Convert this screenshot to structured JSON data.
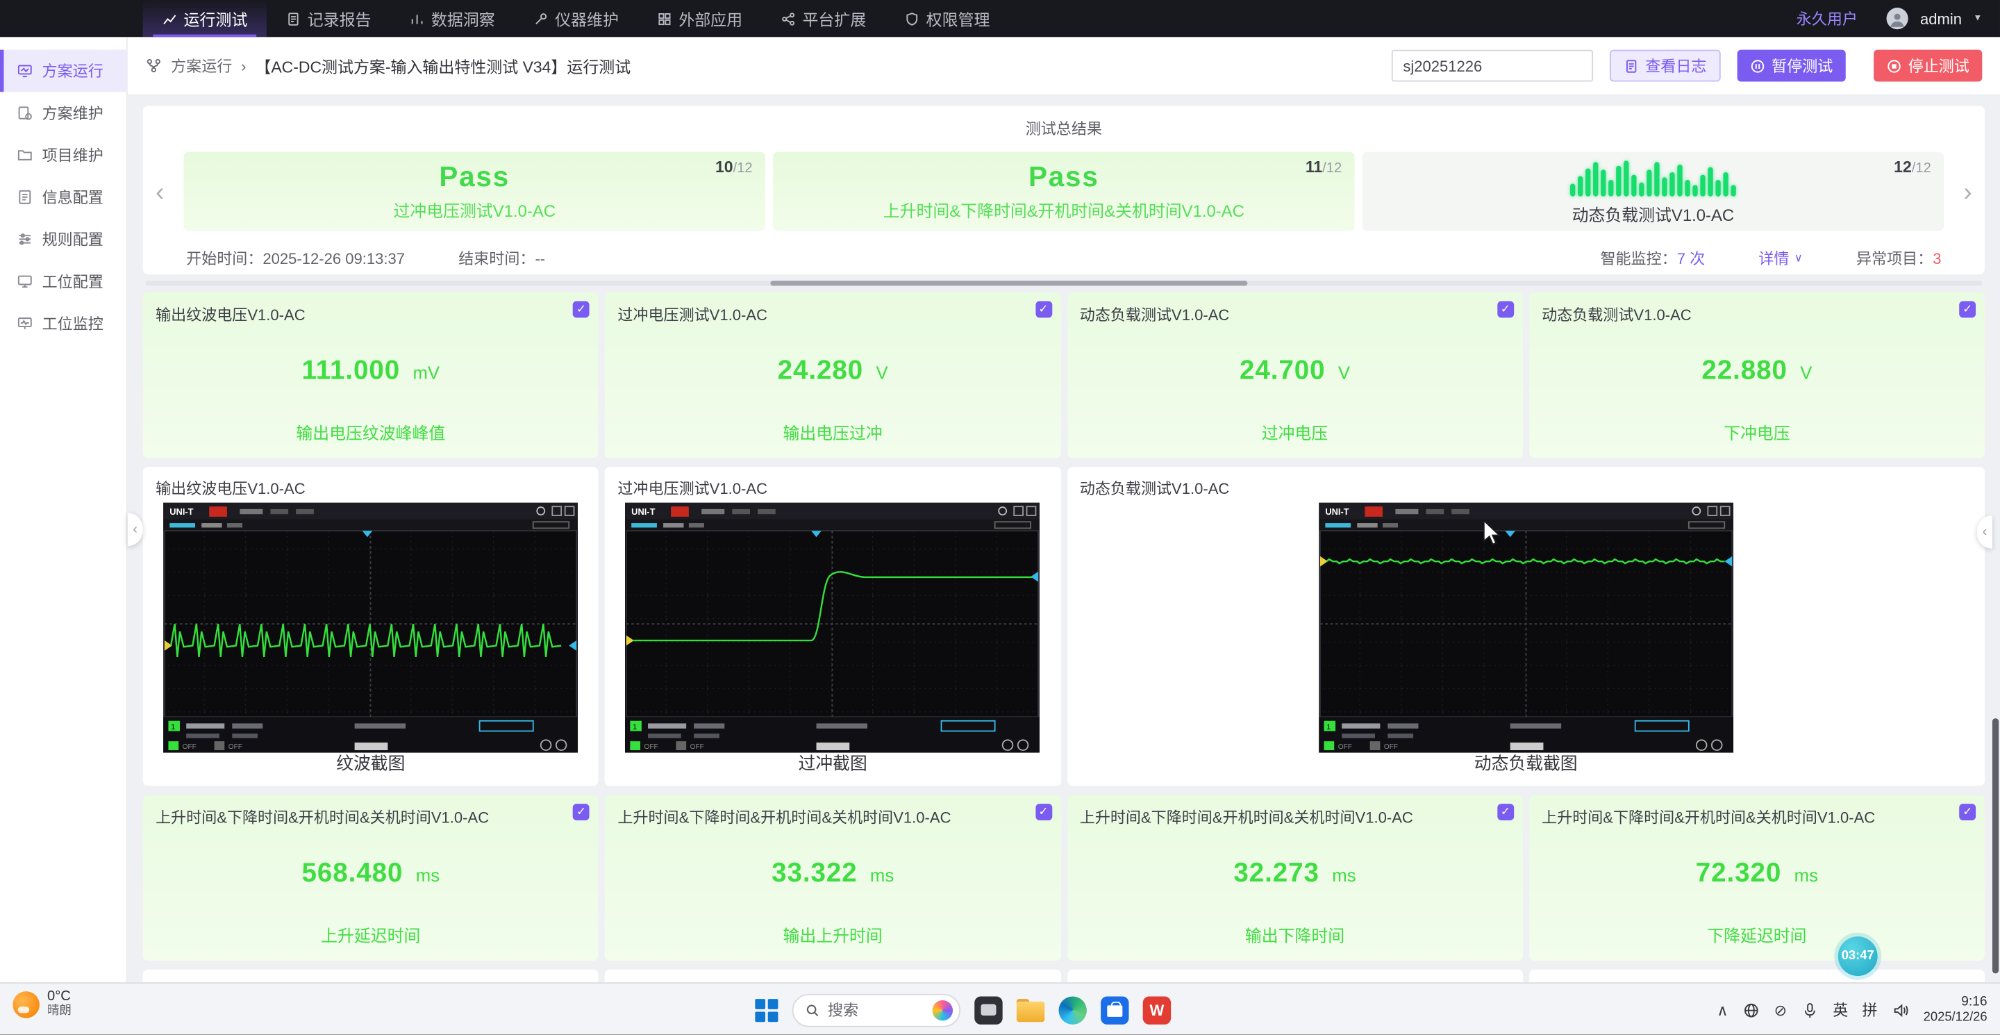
{
  "colors": {
    "accent": "#7b5cf0",
    "danger": "#f25c66",
    "success": "#3fdd41"
  },
  "icons": {
    "check": "✓",
    "caret_solid": "▼",
    "caret_down": "∨",
    "chevron_left": "‹",
    "chevron_right": "›",
    "chevron_up": "∧",
    "dnd": "⊘"
  },
  "topnav": {
    "tabs": [
      {
        "label": "运行测试"
      },
      {
        "label": "记录报告"
      },
      {
        "label": "数据洞察"
      },
      {
        "label": "仪器维护"
      },
      {
        "label": "外部应用"
      },
      {
        "label": "平台扩展"
      },
      {
        "label": "权限管理"
      }
    ],
    "user_type": "永久用户",
    "username": "admin"
  },
  "sidebar": {
    "items": [
      {
        "label": "方案运行"
      },
      {
        "label": "方案维护"
      },
      {
        "label": "项目维护"
      },
      {
        "label": "信息配置"
      },
      {
        "label": "规则配置"
      },
      {
        "label": "工位配置"
      },
      {
        "label": "工位监控"
      }
    ]
  },
  "header": {
    "breadcrumb_root": "方案运行",
    "breadcrumb_sep": "›",
    "breadcrumb_current": "【AC-DC测试方案-输入输出特性测试 V34】运行测试",
    "search_value": "sj20251226",
    "log_button": "查看日志",
    "pause_button": "暂停测试",
    "stop_button": "停止测试"
  },
  "summary": {
    "title": "测试总结果",
    "slides": [
      {
        "status": "Pass",
        "name": "过冲电压测试V1.0-AC",
        "index": "10",
        "total": "/12"
      },
      {
        "status": "Pass",
        "name": "上升时间&下降时间&开机时间&关机时间V1.0-AC",
        "index": "11",
        "total": "/12"
      },
      {
        "name": "动态负载测试V1.0-AC",
        "index": "12",
        "total": "/12"
      }
    ],
    "start_label": "开始时间：",
    "start_value": "2025-12-26 09:13:37",
    "end_label": "结束时间：",
    "end_value": "--",
    "monitor_label": "智能监控：",
    "monitor_count": "7 次",
    "detail_label": "详情",
    "abnormal_label": "异常项目：",
    "abnormal_count": "3"
  },
  "result_cards_row1": [
    {
      "title": "输出纹波电压V1.0-AC",
      "value": "111.000",
      "unit": "mV",
      "metric": "输出电压纹波峰峰值"
    },
    {
      "title": "过冲电压测试V1.0-AC",
      "value": "24.280",
      "unit": "V",
      "metric": "输出电压过冲"
    },
    {
      "title": "动态负载测试V1.0-AC",
      "value": "24.700",
      "unit": "V",
      "metric": "过冲电压"
    },
    {
      "title": "动态负载测试V1.0-AC",
      "value": "22.880",
      "unit": "V",
      "metric": "下冲电压"
    }
  ],
  "screenshot_cards": [
    {
      "title": "输出纹波电压V1.0-AC",
      "caption": "纹波截图"
    },
    {
      "title": "过冲电压测试V1.0-AC",
      "caption": "过冲截图"
    },
    {
      "title": "动态负载测试V1.0-AC",
      "caption": "动态负载截图"
    }
  ],
  "result_cards_row2": [
    {
      "title": "上升时间&下降时间&开机时间&关机时间V1.0-AC",
      "value": "568.480",
      "unit": "ms",
      "metric": "上升延迟时间"
    },
    {
      "title": "上升时间&下降时间&开机时间&关机时间V1.0-AC",
      "value": "33.322",
      "unit": "ms",
      "metric": "输出上升时间"
    },
    {
      "title": "上升时间&下降时间&开机时间&关机时间V1.0-AC",
      "value": "32.273",
      "unit": "ms",
      "metric": "输出下降时间"
    },
    {
      "title": "上升时间&下降时间&开机时间&关机时间V1.0-AC",
      "value": "72.320",
      "unit": "ms",
      "metric": "下降延迟时间"
    }
  ],
  "scope": {
    "brand": "UNI-T",
    "ch1": "1",
    "off": "OFF"
  },
  "timer_badge": "03:47",
  "taskbar": {
    "weather_temp": "0°C",
    "weather_desc": "晴朗",
    "search_placeholder": "搜索",
    "ime_lang": "英",
    "ime_pin": "拼",
    "time": "9:16",
    "date": "2025/12/26"
  }
}
